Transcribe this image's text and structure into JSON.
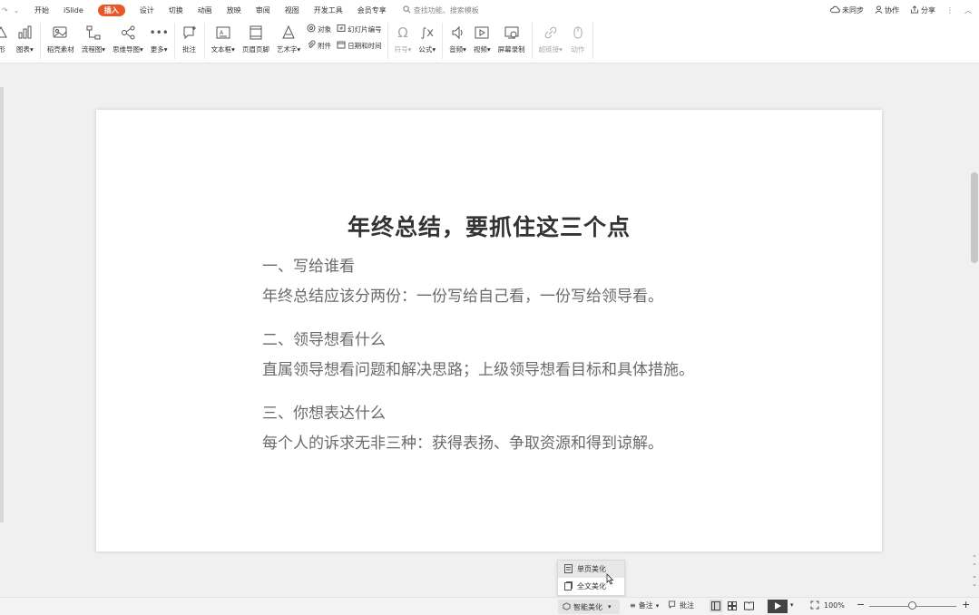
{
  "tabs": [
    "开始",
    "iSlide",
    "插入",
    "设计",
    "切换",
    "动画",
    "放映",
    "审阅",
    "视图",
    "开发工具",
    "会员专享"
  ],
  "active_tab": "插入",
  "search_placeholder": "查找功能、搜索模板",
  "top_right": {
    "sync": "未同步",
    "collab": "协作",
    "share": "分享"
  },
  "ribbon": {
    "shape": "形",
    "chart": "图表",
    "material": "稻壳素材",
    "flowchart": "流程图",
    "mindmap": "思维导图",
    "more": "更多",
    "comment": "批注",
    "textbox": "文本框",
    "header_footer": "页眉页脚",
    "wordart": "艺术字",
    "object": "对象",
    "slide_number": "幻灯片编号",
    "attachment": "附件",
    "datetime": "日期和时间",
    "symbol": "符号",
    "formula": "公式",
    "audio": "音频",
    "video": "视频",
    "screen_record": "屏幕录制",
    "hyperlink": "超链接",
    "action": "动作"
  },
  "slide": {
    "title": "年终总结，要抓住这三个点",
    "sections": [
      {
        "heading": "一、写给谁看",
        "body": "年终总结应该分两份：一份写给自己看，一份写给领导看。"
      },
      {
        "heading": "二、领导想看什么",
        "body": "直属领导想看问题和解决思路；上级领导想看目标和具体措施。"
      },
      {
        "heading": "三、你想表达什么",
        "body": "每个人的诉求无非三种：获得表扬、争取资源和得到谅解。"
      }
    ]
  },
  "popup_menu": {
    "single": "单页美化",
    "full": "全文美化"
  },
  "status_bar": {
    "smart_beautify": "智能美化",
    "notes": "备注",
    "comments": "批注",
    "zoom": "100%",
    "zoom_level": 0.45
  },
  "colors": {
    "accent": "#e8572a",
    "slide_bg": "#ffffff",
    "workspace_bg": "#f0f0f0"
  }
}
